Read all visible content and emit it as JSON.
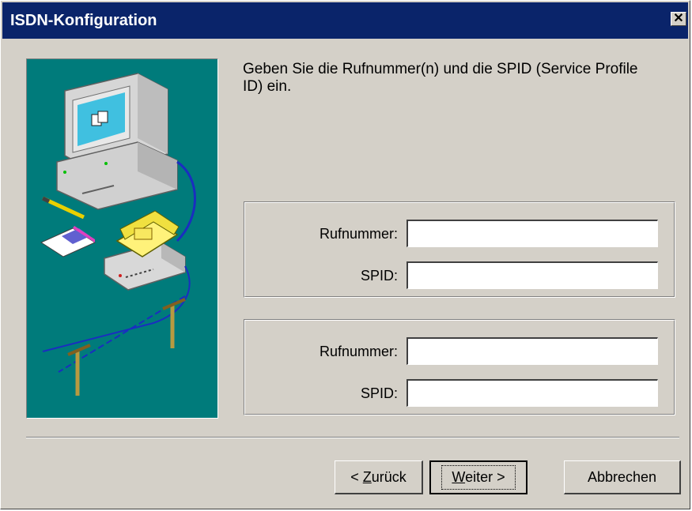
{
  "window": {
    "title": "ISDN-Konfiguration",
    "close_glyph": "✕"
  },
  "main": {
    "intro": "Geben Sie die Rufnummer(n) und die SPID (Service Profile ID) ein.",
    "group1": {
      "number_label": "Rufnummer:",
      "spid_label": "SPID:",
      "number_value": "",
      "spid_value": ""
    },
    "group2": {
      "number_label": "Rufnummer:",
      "spid_label": "SPID:",
      "number_value": "",
      "spid_value": ""
    }
  },
  "buttons": {
    "back_prefix": "< ",
    "back_hotkey": "Z",
    "back_rest": "urück",
    "next_hotkey": "W",
    "next_rest": "eiter >",
    "cancel": "Abbrechen"
  },
  "colors": {
    "titlebar": "#0a246a",
    "dialog": "#d4d0c8",
    "illustration_bg": "#007b7b"
  }
}
